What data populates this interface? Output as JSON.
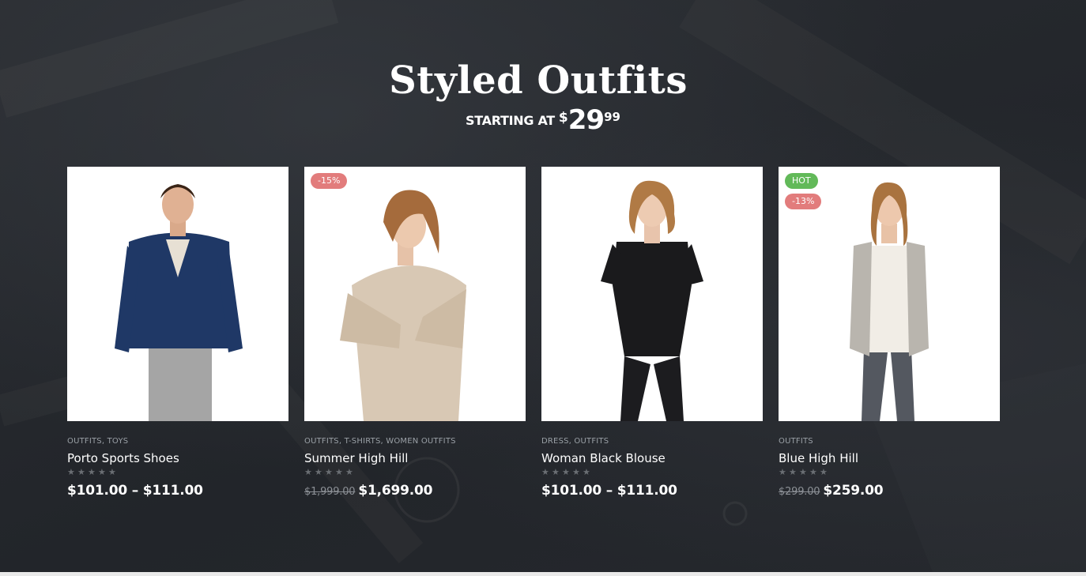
{
  "section": {
    "title": "Styled Outfits",
    "starting_at_label": "STARTING AT",
    "price_currency": "$",
    "price_whole": "29",
    "price_cents": "99"
  },
  "colors": {
    "background": "#24272c",
    "sale_badge": "#e27c7c",
    "hot_badge": "#62b959"
  },
  "products": [
    {
      "categories": "OUTFITS, TOYS",
      "name": "Porto Sports Shoes",
      "rating": 0,
      "price": "$101.00 – $111.00",
      "old_price": "",
      "badges": []
    },
    {
      "categories": "OUTFITS, T-SHIRTS, WOMEN OUTFITS",
      "name": "Summer High Hill",
      "rating": 0,
      "price": "$1,699.00",
      "old_price": "$1,999.00",
      "badges": [
        "-15%"
      ]
    },
    {
      "categories": "DRESS, OUTFITS",
      "name": "Woman Black Blouse",
      "rating": 0,
      "price": "$101.00 – $111.00",
      "old_price": "",
      "badges": []
    },
    {
      "categories": "OUTFITS",
      "name": "Blue High Hill",
      "rating": 0,
      "price": "$259.00",
      "old_price": "$299.00",
      "badges": [
        "HOT",
        "-13%"
      ]
    }
  ]
}
